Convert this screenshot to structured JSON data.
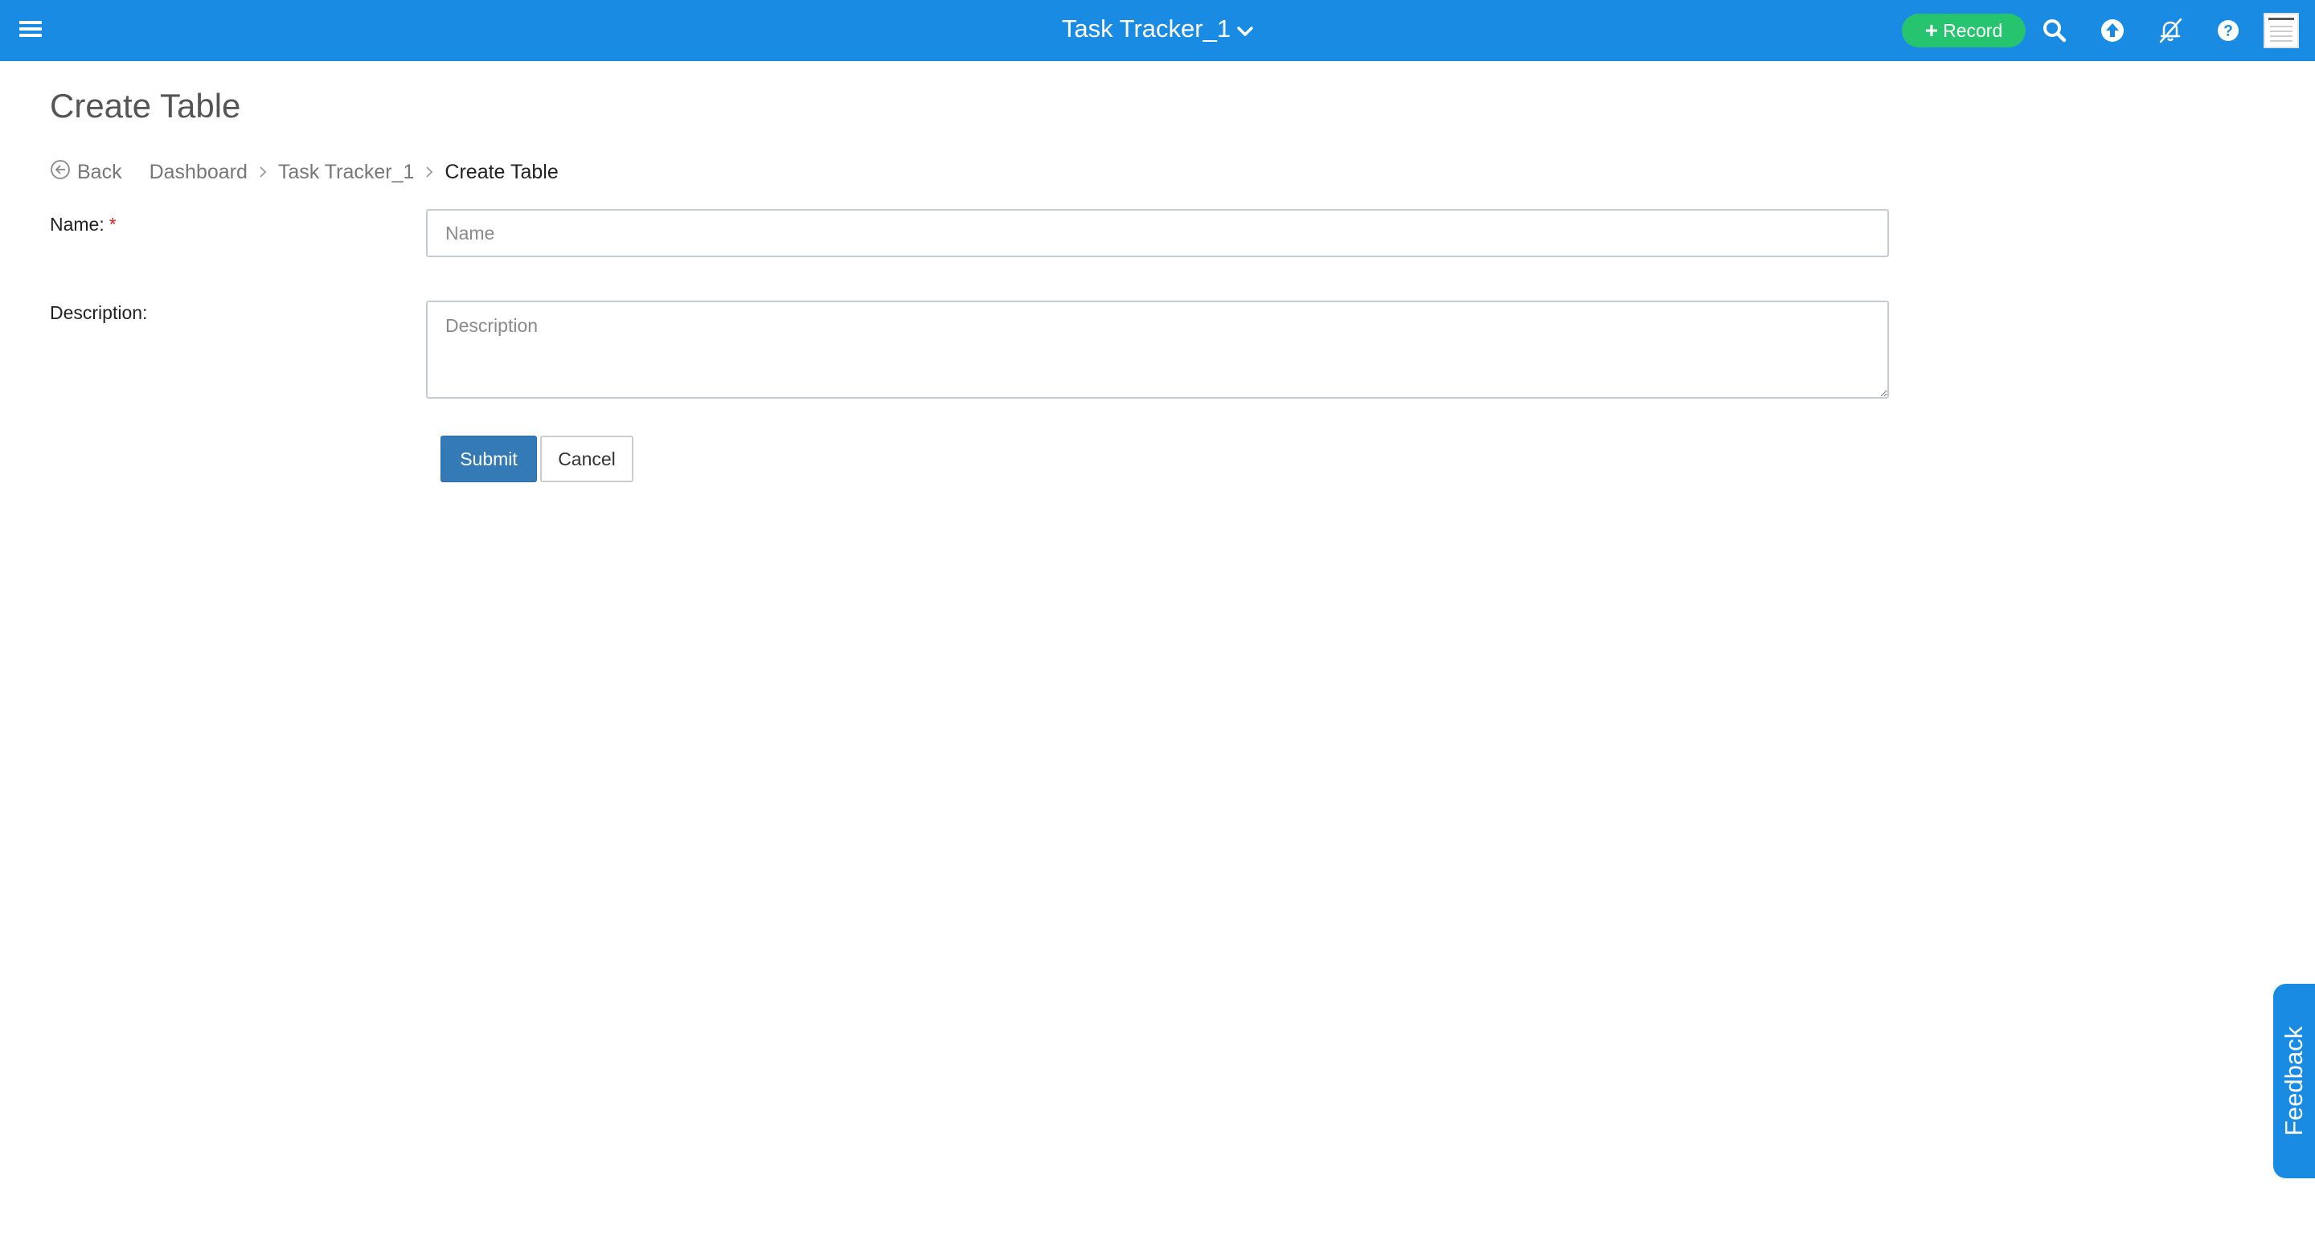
{
  "header": {
    "app_title": "Task Tracker_1",
    "record_label": "Record",
    "icons": [
      "menu-icon",
      "chevron-down-icon",
      "plus-icon",
      "search-icon",
      "upload-icon",
      "notifications-off-icon",
      "help-icon",
      "avatar"
    ]
  },
  "page": {
    "title": "Create Table"
  },
  "breadcrumb": {
    "back_label": "Back",
    "items": [
      "Dashboard",
      "Task Tracker_1",
      "Create Table"
    ]
  },
  "form": {
    "name_label": "Name:",
    "required_marker": "*",
    "name_value": "",
    "name_placeholder": "Name",
    "description_label": "Description:",
    "description_value": "",
    "description_placeholder": "Description",
    "submit_label": "Submit",
    "cancel_label": "Cancel"
  },
  "feedback": {
    "label": "Feedback"
  },
  "colors": {
    "header": "#1a8be3",
    "record_button": "#27c46f",
    "submit_button": "#337ab7",
    "required": "#e02020"
  }
}
